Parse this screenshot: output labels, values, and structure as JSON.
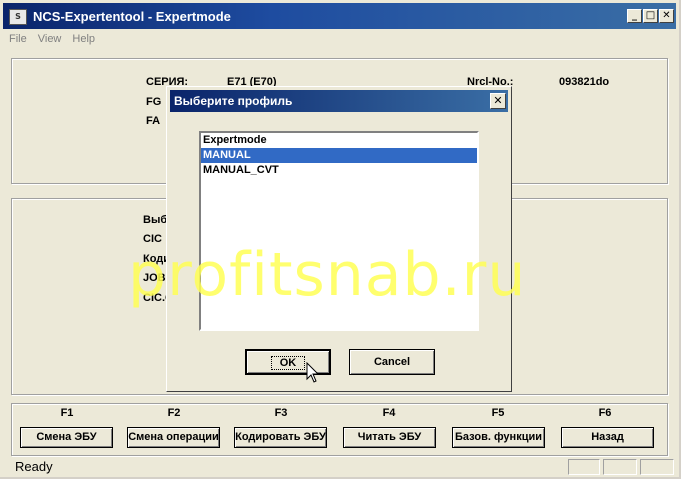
{
  "window": {
    "title": "NCS-Expertentool - Expertmode",
    "app_icon_text": "S"
  },
  "menu": [
    "File",
    "View",
    "Help"
  ],
  "info_panel": {
    "series_label": "СЕРИЯ:",
    "series_value": "E71 (E70)",
    "fg_label": "FG",
    "fa_label": "FA",
    "nrcl_label": "Nrcl-No.:",
    "nrcl_value": "093821do"
  },
  "module_panel": {
    "rows": [
      "Выбр",
      "CIC",
      "Коди",
      "JOBI",
      "CIC.C"
    ]
  },
  "fkeys": [
    {
      "key": "F1",
      "label": "Смена ЭБУ"
    },
    {
      "key": "F2",
      "label": "Смена операции"
    },
    {
      "key": "F3",
      "label": "Кодировать ЭБУ"
    },
    {
      "key": "F4",
      "label": "Читать ЭБУ"
    },
    {
      "key": "F5",
      "label": "Базов. функции"
    },
    {
      "key": "F6",
      "label": "Назад"
    }
  ],
  "status": {
    "text": "Ready"
  },
  "dialog": {
    "title": "Выберите профиль",
    "profiles": [
      "Expertmode",
      "MANUAL",
      "MANUAL_CVT"
    ],
    "selected_index": 1,
    "ok_label": "OK",
    "cancel_label": "Cancel"
  },
  "watermark": "profitsnab.ru",
  "colors": {
    "titlebar": "#0a246a",
    "selection": "#316ac5",
    "window_bg": "#ece9d8"
  }
}
